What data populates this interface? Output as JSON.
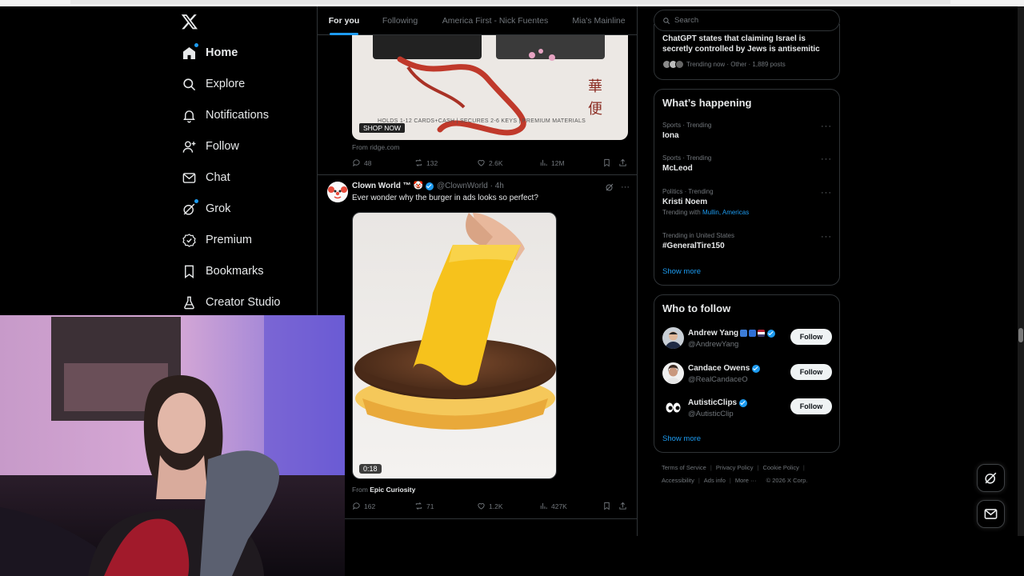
{
  "nav": {
    "logo": "x-logo-icon",
    "items": [
      {
        "label": "Home",
        "icon": "home-icon",
        "active": true
      },
      {
        "label": "Explore",
        "icon": "search-icon"
      },
      {
        "label": "Notifications",
        "icon": "bell-icon"
      },
      {
        "label": "Follow",
        "icon": "add-user-icon"
      },
      {
        "label": "Chat",
        "icon": "envelope-icon"
      },
      {
        "label": "Grok",
        "icon": "grok-icon"
      },
      {
        "label": "Premium",
        "icon": "premium-icon"
      },
      {
        "label": "Bookmarks",
        "icon": "bookmark-icon"
      },
      {
        "label": "Creator Studio",
        "icon": "flask-icon"
      }
    ]
  },
  "tabs": [
    "For you",
    "Following",
    "America First - Nick Fuentes",
    "Mia's Mainline"
  ],
  "feed": {
    "ad": {
      "shop_now": "SHOP NOW",
      "caption": "HOLDS 1-12 CARDS+CASH  |  SECURES 2-6 KEYS  |  PREMIUM MATERIALS",
      "from": "From ridge.com",
      "replies": "48",
      "reposts": "132",
      "likes": "2.6K",
      "views": "12M"
    },
    "post": {
      "name": "Clown World ™ 🤡",
      "handle": "@ClownWorld · 4h",
      "text": "Ever wonder why the burger in ads looks so perfect?",
      "duration": "0:18",
      "from_prefix": "From ",
      "from_source": "Epic Curiosity",
      "replies": "162",
      "reposts": "71",
      "likes": "1.2K",
      "views": "427K"
    }
  },
  "right": {
    "search_placeholder": "Search",
    "top_trend": {
      "headline": "ChatGPT states that claiming Israel is secretly controlled by Jews is antisemitic",
      "meta": "Trending now · Other · 1,889 posts"
    },
    "happening": {
      "title": "What’s happening",
      "trends": [
        {
          "category": "Sports · Trending",
          "name": "Iona"
        },
        {
          "category": "Sports · Trending",
          "name": "McLeod"
        },
        {
          "category": "Politics · Trending",
          "name": "Kristi Noem",
          "with_prefix": "Trending with ",
          "with_links": "Mullin, Americas"
        },
        {
          "category": "Trending in United States",
          "name": "#GeneralTire150"
        }
      ],
      "show_more": "Show more"
    },
    "who_to_follow": {
      "title": "Who to follow",
      "accounts": [
        {
          "name": "Andrew Yang",
          "handle": "@AndrewYang",
          "button": "Follow"
        },
        {
          "name": "Candace Owens",
          "handle": "@RealCandaceO",
          "button": "Follow"
        },
        {
          "name": "AutisticClips",
          "handle": "@AutisticClip",
          "button": "Follow"
        }
      ],
      "show_more": "Show more"
    },
    "footer": {
      "terms": "Terms of Service",
      "privacy": "Privacy Policy",
      "cookie": "Cookie Policy",
      "accessibility": "Accessibility",
      "ads": "Ads info",
      "more": "More ···",
      "copyright": "© 2026 X Corp."
    }
  },
  "colors": {
    "accent": "#1d9bf0",
    "background": "#000000",
    "text": "#e7e9ea",
    "muted": "#71767b",
    "border": "#2f3336"
  }
}
